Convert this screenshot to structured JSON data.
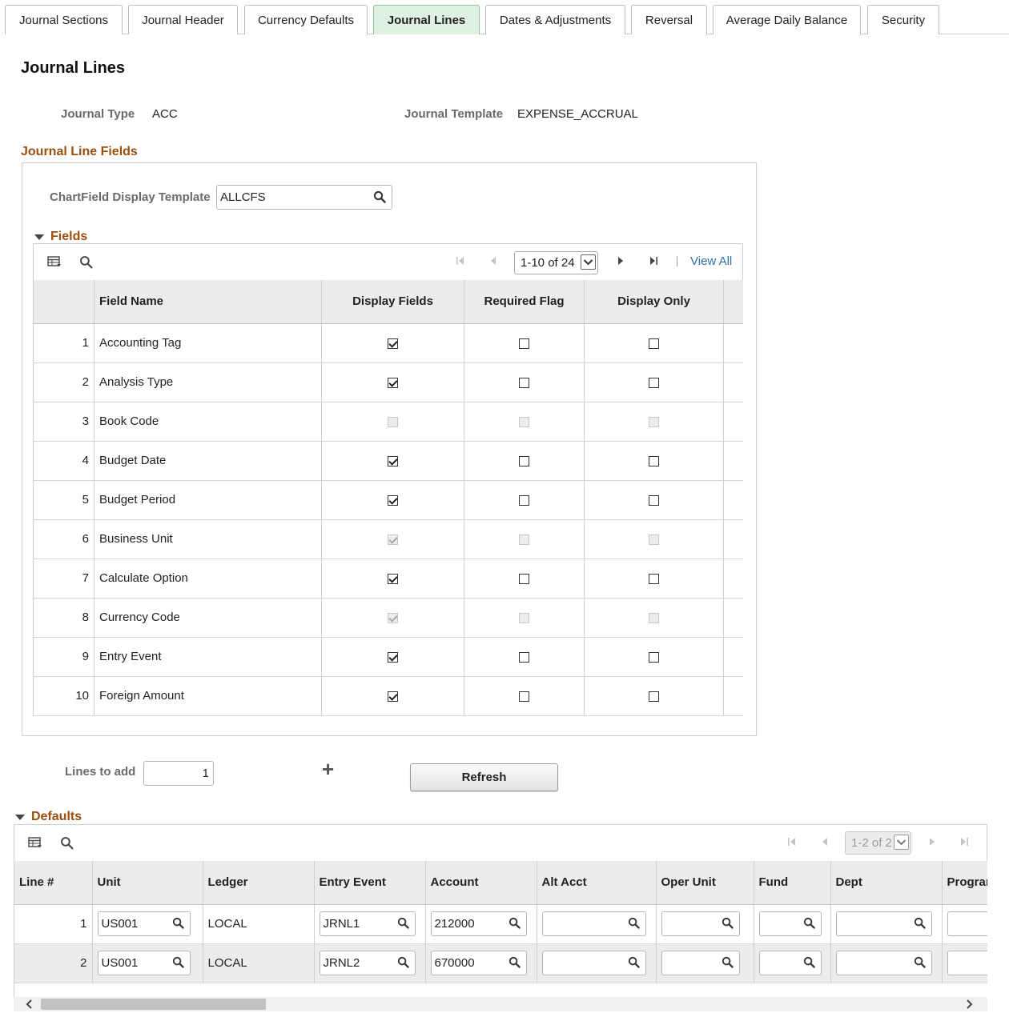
{
  "tabs": [
    {
      "label": "Journal Sections",
      "active": false
    },
    {
      "label": "Journal Header",
      "active": false
    },
    {
      "label": "Currency Defaults",
      "active": false
    },
    {
      "label": "Journal Lines",
      "active": true
    },
    {
      "label": "Dates & Adjustments",
      "active": false
    },
    {
      "label": "Reversal",
      "active": false
    },
    {
      "label": "Average Daily Balance",
      "active": false
    },
    {
      "label": "Security",
      "active": false
    }
  ],
  "page": {
    "title": "Journal Lines",
    "journal_type_label": "Journal Type",
    "journal_type_value": "ACC",
    "journal_template_label": "Journal Template",
    "journal_template_value": "EXPENSE_ACCRUAL"
  },
  "journal_line_fields": {
    "section_title": "Journal Line Fields",
    "chartfield_label": "ChartField Display Template",
    "chartfield_value": "ALLCFS",
    "fields_title": "Fields",
    "pager_text": "1-10 of 24",
    "view_all": "View All",
    "columns": [
      "Field Name",
      "Display Fields",
      "Required Flag",
      "Display Only"
    ],
    "rows": [
      {
        "num": "1",
        "name": "Accounting Tag",
        "display": true,
        "display_disabled": false,
        "required": false,
        "required_disabled": false,
        "display_only": false,
        "display_only_disabled": false
      },
      {
        "num": "2",
        "name": "Analysis Type",
        "display": true,
        "display_disabled": false,
        "required": false,
        "required_disabled": false,
        "display_only": false,
        "display_only_disabled": false
      },
      {
        "num": "3",
        "name": "Book Code",
        "display": false,
        "display_disabled": true,
        "required": false,
        "required_disabled": true,
        "display_only": false,
        "display_only_disabled": true
      },
      {
        "num": "4",
        "name": "Budget Date",
        "display": true,
        "display_disabled": false,
        "required": false,
        "required_disabled": false,
        "display_only": false,
        "display_only_disabled": false
      },
      {
        "num": "5",
        "name": "Budget Period",
        "display": true,
        "display_disabled": false,
        "required": false,
        "required_disabled": false,
        "display_only": false,
        "display_only_disabled": false
      },
      {
        "num": "6",
        "name": "Business Unit",
        "display": true,
        "display_disabled": true,
        "required": false,
        "required_disabled": true,
        "display_only": false,
        "display_only_disabled": true
      },
      {
        "num": "7",
        "name": "Calculate Option",
        "display": true,
        "display_disabled": false,
        "required": false,
        "required_disabled": false,
        "display_only": false,
        "display_only_disabled": false
      },
      {
        "num": "8",
        "name": "Currency Code",
        "display": true,
        "display_disabled": true,
        "required": false,
        "required_disabled": true,
        "display_only": false,
        "display_only_disabled": true
      },
      {
        "num": "9",
        "name": "Entry Event",
        "display": true,
        "display_disabled": false,
        "required": false,
        "required_disabled": false,
        "display_only": false,
        "display_only_disabled": false
      },
      {
        "num": "10",
        "name": "Foreign Amount",
        "display": true,
        "display_disabled": false,
        "required": false,
        "required_disabled": false,
        "display_only": false,
        "display_only_disabled": false
      }
    ]
  },
  "add_lines": {
    "label": "Lines to add",
    "value": "1",
    "plus_symbol": "+",
    "refresh_label": "Refresh"
  },
  "defaults": {
    "title": "Defaults",
    "pager_text": "1-2 of 2",
    "columns": [
      "Line #",
      "Unit",
      "Ledger",
      "Entry Event",
      "Account",
      "Alt Acct",
      "Oper Unit",
      "Fund",
      "Dept",
      "Program"
    ],
    "rows": [
      {
        "line": "1",
        "unit": "US001",
        "ledger": "LOCAL",
        "entry_event": "JRNL1",
        "account": "212000",
        "alt_acct": "",
        "oper_unit": "",
        "fund": "",
        "dept": "",
        "program": ""
      },
      {
        "line": "2",
        "unit": "US001",
        "ledger": "LOCAL",
        "entry_event": "JRNL2",
        "account": "670000",
        "alt_acct": "",
        "oper_unit": "",
        "fund": "",
        "dept": "",
        "program": ""
      }
    ]
  }
}
